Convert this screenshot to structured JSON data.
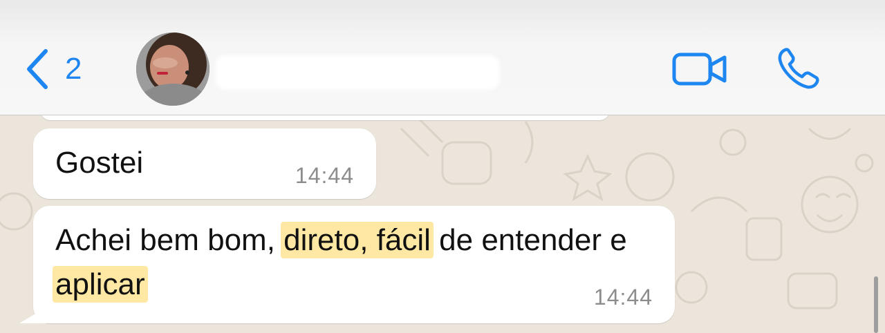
{
  "header": {
    "unread_count": "2",
    "contact_name": ""
  },
  "messages": [
    {
      "text": "Gostei",
      "time": "14:44"
    },
    {
      "parts": [
        {
          "text": "Achei bem bom, ",
          "highlight": false
        },
        {
          "text": "direto, fácil",
          "highlight": true
        },
        {
          "text": " de entender e ",
          "highlight": false
        },
        {
          "text": "aplicar",
          "highlight": true
        }
      ],
      "time": "14:44"
    }
  ],
  "colors": {
    "accent": "#1d86f0",
    "bubble": "#ffffff",
    "highlight": "#ffd65a",
    "wallpaper": "#ebe5dc",
    "timestamp": "#8c8c8c"
  },
  "icons": [
    "chevron-left-icon",
    "video-call-icon",
    "phone-icon"
  ]
}
